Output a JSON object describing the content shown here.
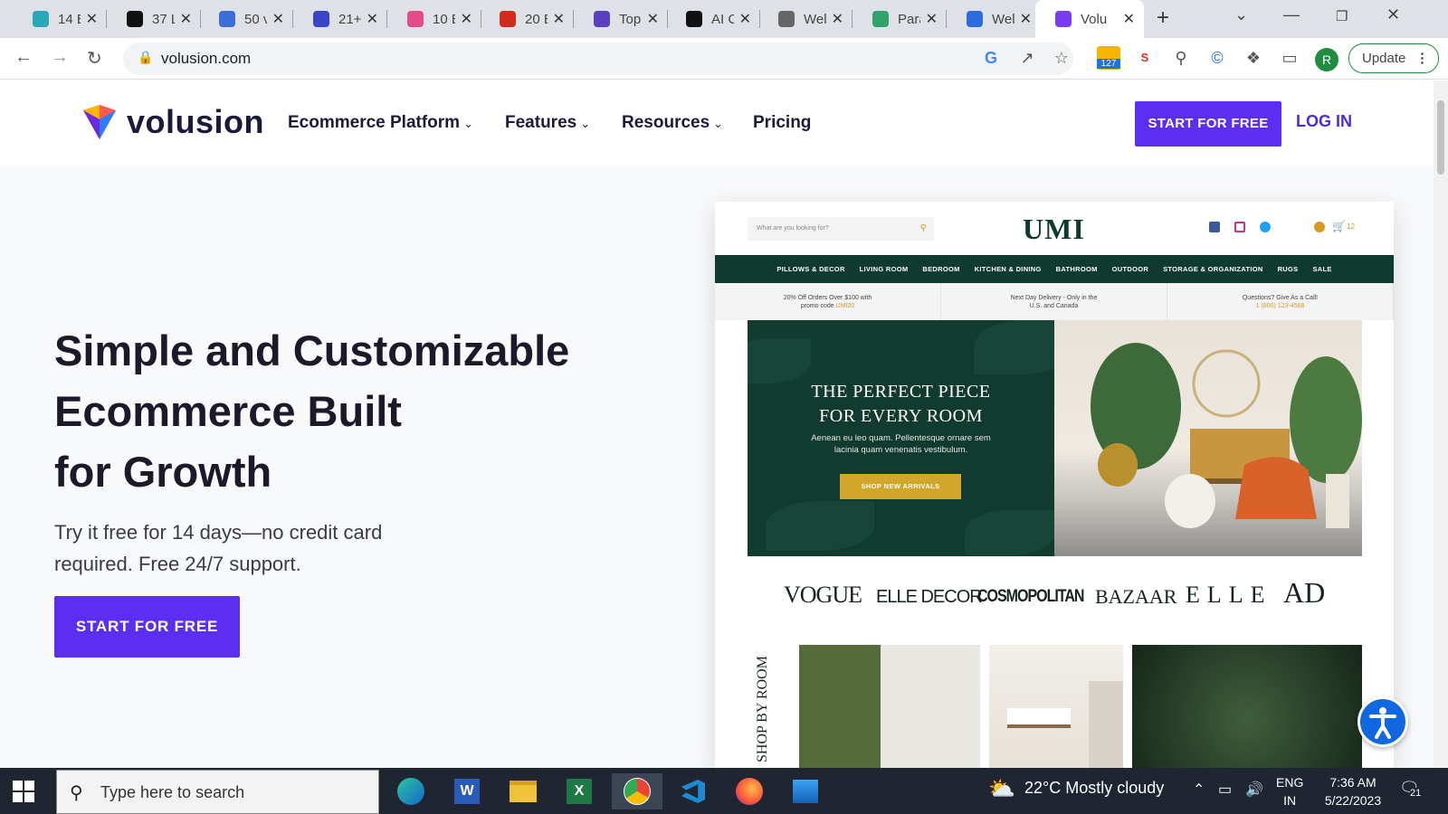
{
  "browser": {
    "tabs": [
      {
        "label": "14 E",
        "color": "#2aa7b8"
      },
      {
        "label": "37 L",
        "color": "#111111"
      },
      {
        "label": "50 v",
        "color": "#3b6fd8"
      },
      {
        "label": "21+",
        "color": "#3b46c7"
      },
      {
        "label": "10 E",
        "color": "#e44b8a"
      },
      {
        "label": "20 E",
        "color": "#d22a1c"
      },
      {
        "label": "Top",
        "color": "#5a3fc0"
      },
      {
        "label": "AI C",
        "color": "#111111"
      },
      {
        "label": "Wel",
        "color": "#666666"
      },
      {
        "label": "Para",
        "color": "#2fa36b"
      },
      {
        "label": "Wel",
        "color": "#2c6cdf"
      },
      {
        "label": "Volu",
        "color": "#7b3cf0"
      }
    ],
    "url": "volusion.com",
    "update_label": "Update",
    "profile_initial": "R",
    "extension_badge": "127"
  },
  "site": {
    "brand": "volusion",
    "nav": [
      {
        "label": "Ecommerce Platform",
        "has_dropdown": true
      },
      {
        "label": "Features",
        "has_dropdown": true
      },
      {
        "label": "Resources",
        "has_dropdown": true
      },
      {
        "label": "Pricing",
        "has_dropdown": false
      }
    ],
    "header_cta": "START FOR FREE",
    "login": "LOG IN",
    "hero": {
      "title_lines": [
        "Simple and Customizable",
        "Ecommerce Built",
        "for Growth"
      ],
      "subtitle_lines": [
        "Try it free for 14 days—no credit card",
        "required. Free 24/7 support."
      ],
      "cta": "START FOR FREE"
    },
    "accent_color": "#5b2ef2"
  },
  "mockup": {
    "search_placeholder": "What are you looking for?",
    "logo": "UMI",
    "cart_count": "12",
    "nav": [
      "PILLOWS & DECOR",
      "LIVING ROOM",
      "BEDROOM",
      "KITCHEN & DINING",
      "BATHROOM",
      "OUTDOOR",
      "STORAGE & ORGANIZATION",
      "RUGS",
      "SALE"
    ],
    "promos": [
      {
        "text": "20% Off Orders Over $100 with",
        "text2": "promo code",
        "highlight": "UMI20"
      },
      {
        "text": "Next Day Delivery - Only in the",
        "text2": "U.S. and Canada",
        "highlight": ""
      },
      {
        "text": "Questions? Give As a Call!",
        "text2": "",
        "highlight": "1 (800) 123-4568"
      }
    ],
    "hero_title_lines": [
      "THE PERFECT PIECE",
      "FOR EVERY ROOM"
    ],
    "hero_text_lines": [
      "Aenean eu leo quam. Pellentesque ornare sem",
      "lacinia quam venenatis vestibulum."
    ],
    "hero_button": "SHOP NEW ARRIVALS",
    "press": [
      "VOGUE",
      "ELLE DECOR",
      "COSMOPOLITAN",
      "BAZAAR",
      "ELLE",
      "AD"
    ],
    "shop_by_room": "SHOP BY ROOM"
  },
  "taskbar": {
    "search_placeholder": "Type here to search",
    "weather": "22°C  Mostly cloudy",
    "lang_line1": "ENG",
    "lang_line2": "IN",
    "time": "7:36 AM",
    "date": "5/22/2023",
    "notification_count": "21"
  }
}
